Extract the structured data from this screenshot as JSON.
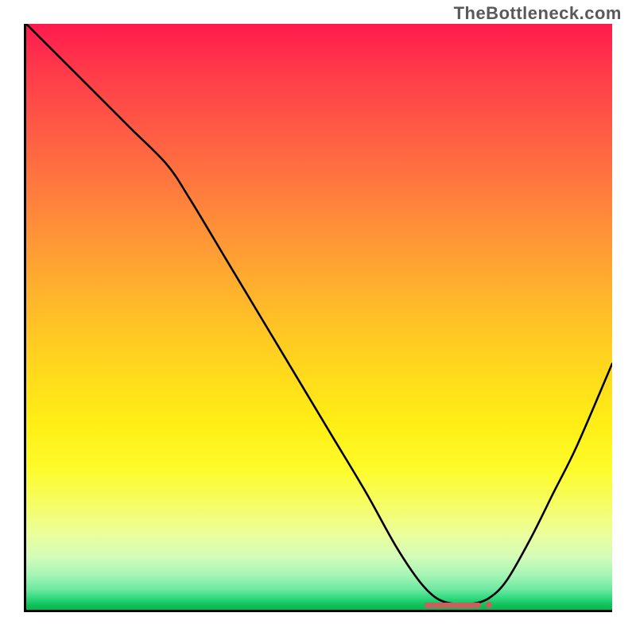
{
  "watermark": "TheBottleneck.com",
  "chart_data": {
    "type": "line",
    "title": "",
    "xlabel": "",
    "ylabel": "",
    "xlim": [
      0,
      100
    ],
    "ylim": [
      0,
      100
    ],
    "grid": false,
    "legend": false,
    "background": "rainbow-gradient-red-to-green",
    "series": [
      {
        "name": "bottleneck-curve",
        "color": "#000000",
        "x": [
          0,
          6,
          12,
          18,
          24,
          28,
          34,
          40,
          46,
          52,
          58,
          63,
          67,
          70,
          73,
          76,
          79,
          82,
          86,
          90,
          94,
          100
        ],
        "values": [
          100,
          94,
          88,
          82,
          76,
          70,
          60,
          50,
          40,
          30,
          20,
          11,
          5,
          2,
          1,
          1,
          2,
          5,
          12,
          20,
          28,
          42
        ]
      }
    ],
    "flat_region": {
      "x_start": 68,
      "x_end": 79,
      "y": 0.8
    },
    "annotations": []
  }
}
